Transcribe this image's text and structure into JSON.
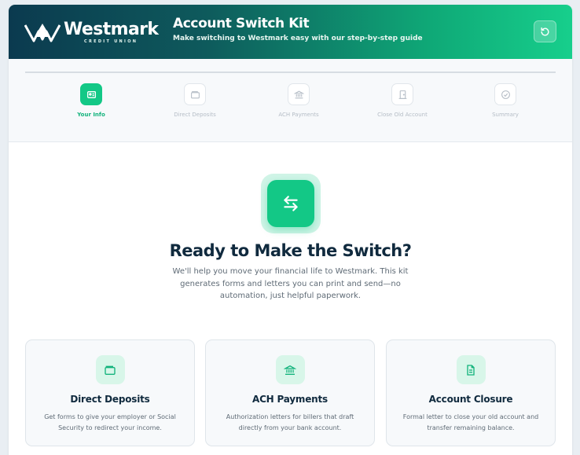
{
  "brand": {
    "name": "Westmark",
    "sub": "CREDIT UNION"
  },
  "header": {
    "title": "Account Switch Kit",
    "subtitle": "Make switching to Westmark easy with our step-by-step guide",
    "refresh_icon": "refresh-icon"
  },
  "steps": [
    {
      "label": "Your Info",
      "icon": "id-card-icon",
      "active": true
    },
    {
      "label": "Direct Deposits",
      "icon": "wallet-icon",
      "active": false
    },
    {
      "label": "ACH Payments",
      "icon": "bank-icon",
      "active": false
    },
    {
      "label": "Close Old Account",
      "icon": "door-icon",
      "active": false
    },
    {
      "label": "Summary",
      "icon": "check-circle-icon",
      "active": false
    }
  ],
  "hero": {
    "icon": "swap-arrows-icon",
    "title": "Ready to Make the Switch?",
    "description": "We'll help you move your financial life to Westmark. This kit generates forms and letters you can print and send—no automation, just helpful paperwork."
  },
  "features": [
    {
      "title": "Direct Deposits",
      "description": "Get forms to give your employer or Social Security to redirect your income.",
      "icon": "wallet-icon"
    },
    {
      "title": "ACH Payments",
      "description": "Authorization letters for billers that draft directly from your bank account.",
      "icon": "bank-icon"
    },
    {
      "title": "Account Closure",
      "description": "Formal letter to close your old account and transfer remaining balance.",
      "icon": "document-icon"
    }
  ],
  "colors": {
    "accent": "#13c886",
    "header_dark": "#0b3a4f",
    "header_light": "#17cf8c",
    "text_dark": "#102a3e"
  }
}
